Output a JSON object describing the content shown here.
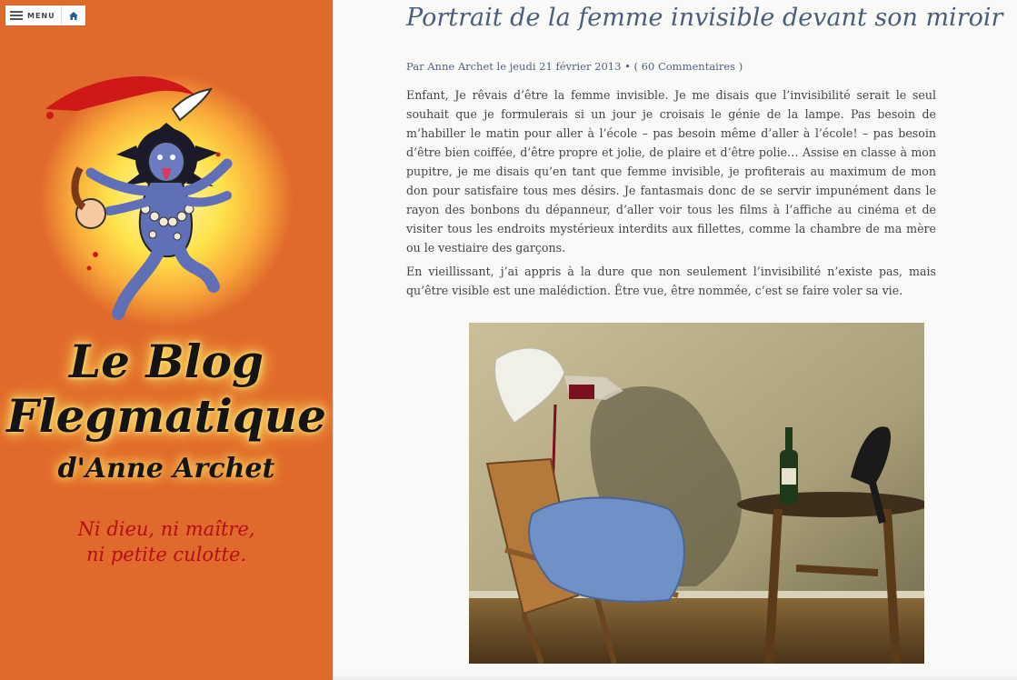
{
  "sidebar": {
    "menu_label": "MENU",
    "blog_title_line1": "Le Blog",
    "blog_title_line2": "Flegmatique",
    "blog_subtitle": "d'Anne Archet",
    "tagline_line1": "Ni dieu, ni maître,",
    "tagline_line2": "ni petite culotte.",
    "background_color": "#e0692c",
    "tagline_color": "#b31016"
  },
  "post": {
    "title": "Portrait de la femme invisible devant son miroir",
    "meta_prefix": "Par",
    "author": "Anne Archet",
    "date_prefix": "le",
    "date": "jeudi 21 février 2013",
    "separator": "•",
    "comments": "( 60 Commentaires )",
    "paragraphs": [
      "Enfant, Je rêvais d’être la femme invisible. Je me disais que l’invisibilité serait le seul souhait que je formulerais si un jour je croisais le génie de la lampe. Pas besoin de m’habiller le matin pour aller à l’école – pas besoin même d’aller à l’école! – pas besoin d’être bien coiffée, d’être propre et jolie, de plaire et d’être polie… Assise en classe à mon pupitre, je me disais qu’en tant que femme invisible, je profiterais au maximum de mon don pour satisfaire tous mes désirs. Je fantasmais donc de se servir impunément dans le rayon des bonbons du dépanneur, d’aller voir tous les films à l’affiche au cinéma et de visiter tous les endroits mystérieux interdits aux fillettes, comme la chambre de ma mère ou le vestiaire des garçons.",
      "En vieillissant, j’ai appris à la dure que non seulement l’invisibilité n’existe pas, mais qu’être visible est une malédiction. Être vue, être nommée, c’est se faire voler sa vie."
    ],
    "title_color": "#4b5d7a"
  },
  "icons": {
    "menu": "hamburger-icon",
    "home": "home-icon"
  }
}
